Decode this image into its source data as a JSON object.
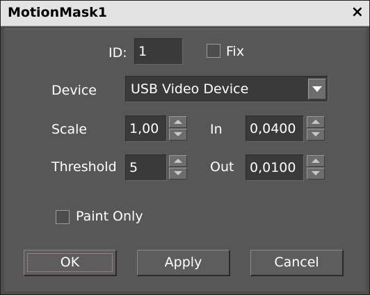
{
  "window": {
    "title": "MotionMask1",
    "close_glyph": "×"
  },
  "form": {
    "id_label": "ID:",
    "id_value": "1",
    "fix_label": "Fix",
    "fix_checked": false,
    "device_label": "Device",
    "device_value": "USB Video Device",
    "scale_label": "Scale",
    "scale_value": "1,00",
    "in_label": "In",
    "in_value": "0,0400",
    "threshold_label": "Threshold",
    "threshold_value": "5",
    "out_label": "Out",
    "out_value": "0,0100",
    "paint_only_label": "Paint Only",
    "paint_only_checked": false
  },
  "buttons": {
    "ok_label": "OK",
    "apply_label": "Apply",
    "cancel_label": "Cancel"
  },
  "colors": {
    "background": "#575757",
    "titlebar": "#e3e3e3",
    "text": "#ffffff"
  }
}
